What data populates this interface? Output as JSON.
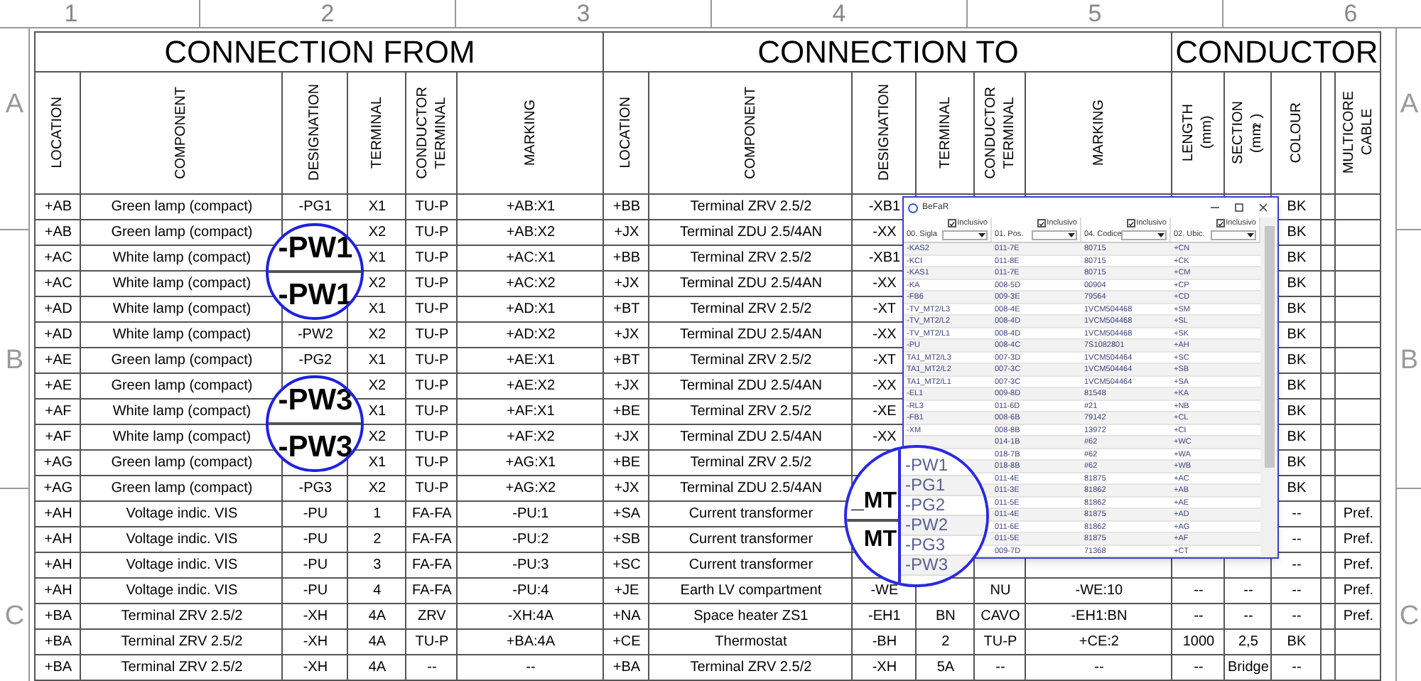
{
  "sheet": {
    "column_numbers": [
      "1",
      "2",
      "3",
      "4",
      "5",
      "6"
    ],
    "row_letters_left": [
      "A",
      "B",
      "C"
    ],
    "row_letters_right": [
      "A",
      "B",
      "C"
    ]
  },
  "table": {
    "groups": [
      {
        "title": "CONNECTION FROM",
        "columns": [
          {
            "label": "LOCATION"
          },
          {
            "label": "COMPONENT"
          },
          {
            "label": "DESIGNATION"
          },
          {
            "label": "TERMINAL"
          },
          {
            "label": "CONDUCTOR\nTERMINAL"
          },
          {
            "label": "MARKING"
          }
        ]
      },
      {
        "title": "CONNECTION TO",
        "columns": [
          {
            "label": "LOCATION"
          },
          {
            "label": "COMPONENT"
          },
          {
            "label": "DESIGNATION"
          },
          {
            "label": "TERMINAL"
          },
          {
            "label": "CONDUCTOR\nTERMINAL"
          },
          {
            "label": "MARKING"
          }
        ]
      },
      {
        "title": "CONDUCTOR",
        "columns": [
          {
            "label": "LENGTH\n(mm)"
          },
          {
            "label": "SECTION\n(mm$^{2}$)"
          },
          {
            "label": "COLOUR"
          },
          {
            "label": "MULTICORE\nCABLE"
          }
        ]
      }
    ],
    "rows": [
      {
        "cells": [
          "+AB",
          "Green lamp (compact)",
          "-PG1",
          "X1",
          "TU-P",
          "+AB:X1",
          "+BB",
          "Terminal ZRV 2.5/2",
          "-XB1",
          null,
          null,
          null,
          null,
          null,
          "BK",
          null,
          null
        ]
      },
      {
        "cells": [
          "+AB",
          "Green lamp (compact)",
          null,
          "X2",
          "TU-P",
          "+AB:X2",
          "+JX",
          "Terminal ZDU 2.5/4AN",
          "-XX",
          null,
          null,
          null,
          null,
          null,
          "BK",
          null,
          null
        ]
      },
      {
        "cells": [
          "+AC",
          "White lamp (compact)",
          null,
          "X1",
          "TU-P",
          "+AC:X1",
          "+BB",
          "Terminal ZRV 2.5/2",
          "-XB1",
          null,
          null,
          null,
          null,
          null,
          "BK",
          null,
          null
        ]
      },
      {
        "cells": [
          "+AC",
          "White lamp (compact)",
          null,
          "X2",
          "TU-P",
          "+AC:X2",
          "+JX",
          "Terminal ZDU 2.5/4AN",
          "-XX",
          null,
          null,
          null,
          null,
          null,
          "BK",
          null,
          null
        ]
      },
      {
        "cells": [
          "+AD",
          "White lamp (compact)",
          null,
          "X1",
          "TU-P",
          "+AD:X1",
          "+BT",
          "Terminal ZRV 2.5/2",
          "-XT",
          null,
          null,
          null,
          null,
          null,
          "BK",
          null,
          null
        ]
      },
      {
        "cells": [
          "+AD",
          "White lamp (compact)",
          "-PW2",
          "X2",
          "TU-P",
          "+AD:X2",
          "+JX",
          "Terminal ZDU 2.5/4AN",
          "-XX",
          null,
          null,
          null,
          null,
          null,
          "BK",
          null,
          null
        ]
      },
      {
        "cells": [
          "+AE",
          "Green lamp (compact)",
          "-PG2",
          "X1",
          "TU-P",
          "+AE:X1",
          "+BT",
          "Terminal ZRV 2.5/2",
          "-XT",
          null,
          null,
          null,
          null,
          null,
          "BK",
          null,
          null
        ]
      },
      {
        "cells": [
          "+AE",
          "Green lamp (compact)",
          null,
          "X2",
          "TU-P",
          "+AE:X2",
          "+JX",
          "Terminal ZDU 2.5/4AN",
          "-XX",
          null,
          null,
          null,
          null,
          null,
          "BK",
          null,
          null
        ]
      },
      {
        "cells": [
          "+AF",
          "White lamp (compact)",
          null,
          "X1",
          "TU-P",
          "+AF:X1",
          "+BE",
          "Terminal ZRV 2.5/2",
          "-XE",
          null,
          null,
          null,
          null,
          null,
          "BK",
          null,
          null
        ]
      },
      {
        "cells": [
          "+AF",
          "White lamp (compact)",
          null,
          "X2",
          "TU-P",
          "+AF:X2",
          "+JX",
          "Terminal ZDU 2.5/4AN",
          "-XX",
          null,
          null,
          null,
          null,
          null,
          "BK",
          null,
          null
        ]
      },
      {
        "cells": [
          "+AG",
          "Green lamp (compact)",
          null,
          "X1",
          "TU-P",
          "+AG:X1",
          "+BE",
          "Terminal ZRV 2.5/2",
          null,
          null,
          null,
          null,
          null,
          null,
          "BK",
          null,
          null
        ]
      },
      {
        "cells": [
          "+AG",
          "Green lamp (compact)",
          "-PG3",
          "X2",
          "TU-P",
          "+AG:X2",
          "+JX",
          "Terminal ZDU 2.5/4AN",
          null,
          null,
          null,
          null,
          null,
          null,
          "BK",
          null,
          null
        ]
      },
      {
        "cells": [
          "+AH",
          "Voltage indic. VIS",
          "-PU",
          "1",
          "FA-FA",
          "-PU:1",
          "+SA",
          "Current transformer",
          null,
          null,
          null,
          null,
          null,
          null,
          "--",
          null,
          "Pref."
        ]
      },
      {
        "cells": [
          "+AH",
          "Voltage indic. VIS",
          "-PU",
          "2",
          "FA-FA",
          "-PU:2",
          "+SB",
          "Current transformer",
          null,
          null,
          null,
          null,
          null,
          null,
          "--",
          null,
          "Pref."
        ]
      },
      {
        "cells": [
          "+AH",
          "Voltage indic. VIS",
          "-PU",
          "3",
          "FA-FA",
          "-PU:3",
          "+SC",
          "Current transformer",
          null,
          null,
          null,
          null,
          null,
          null,
          "--",
          null,
          "Pref."
        ]
      },
      {
        "cells": [
          "+AH",
          "Voltage indic. VIS",
          "-PU",
          "4",
          "FA-FA",
          "-PU:4",
          "+JE",
          "Earth LV compartment",
          "-WE",
          null,
          "NU",
          "-WE:10",
          "--",
          "--",
          "--",
          null,
          "Pref."
        ]
      },
      {
        "cells": [
          "+BA",
          "Terminal ZRV 2.5/2",
          "-XH",
          "4A",
          "ZRV",
          "-XH:4A",
          "+NA",
          "Space heater ZS1",
          "-EH1",
          "BN",
          "CAVO",
          "-EH1:BN",
          "--",
          "--",
          "--",
          null,
          "Pref."
        ]
      },
      {
        "cells": [
          "+BA",
          "Terminal ZRV 2.5/2",
          "-XH",
          "4A",
          "TU-P",
          "+BA:4A",
          "+CE",
          "Thermostat",
          "-BH",
          "2",
          "TU-P",
          "+CE:2",
          "1000",
          "2,5",
          "BK",
          null,
          null
        ]
      },
      {
        "cells": [
          "+BA",
          "Terminal ZRV 2.5/2",
          "-XH",
          "4A",
          "--",
          "--",
          "+BA",
          "Terminal ZRV 2.5/2",
          "-XH",
          "5A",
          "--",
          "--",
          "--",
          "Bridge",
          "--",
          null,
          null
        ]
      }
    ]
  },
  "callouts": [
    {
      "top": "-PW1",
      "bottom": "-PW1"
    },
    {
      "top": "-PW3",
      "bottom": "-PW3"
    }
  ],
  "window": {
    "title": "BeFaR",
    "columns": [
      {
        "label": "00. Sigla",
        "checkbox_label": "Inclusivo",
        "inclusive": true
      },
      {
        "label": "01. Pos.",
        "checkbox_label": "Inclusivo",
        "inclusive": true
      },
      {
        "label": "04. Codice",
        "checkbox_label": "Inclusivo",
        "inclusive": true
      },
      {
        "label": "02. Ubic.",
        "checkbox_label": "Inclusivo",
        "inclusive": true
      }
    ],
    "rows": [
      [
        "-KAS2",
        "011-7E",
        "80715",
        "+CN"
      ],
      [
        "-KCI",
        "011-8E",
        "80715",
        "+CK"
      ],
      [
        "-KAS1",
        "011-7E",
        "80715",
        "+CM"
      ],
      [
        "-KA",
        "008-5D",
        "00904",
        "+CP"
      ],
      [
        "-FB6",
        "009-3E",
        "79564",
        "+CD"
      ],
      [
        "-TV_MT2/L3",
        "008-4E",
        "1VCM504468",
        "+SM"
      ],
      [
        "-TV_MT2/L2",
        "008-4D",
        "1VCM504468",
        "+SL"
      ],
      [
        "-TV_MT2/L1",
        "008-4D",
        "1VCM504468",
        "+SK"
      ],
      [
        "-PU",
        "008-4C",
        "7S1082801",
        "+AH"
      ],
      [
        "TA1_MT2/L3",
        "007-3D",
        "1VCM504464",
        "+SC"
      ],
      [
        "TA1_MT2/L2",
        "007-3C",
        "1VCM504464",
        "+SB"
      ],
      [
        "TA1_MT2/L1",
        "007-3C",
        "1VCM504464",
        "+SA"
      ],
      [
        "-EL1",
        "009-8D",
        "81548",
        "+KA"
      ],
      [
        "-RL3",
        "011-6D",
        "#21",
        "+NB"
      ],
      [
        "-FB1",
        "008-6B",
        "79142",
        "+CL"
      ],
      [
        "-XM",
        "008-8B",
        "13972",
        "+CI"
      ],
      [
        null,
        "014-1B",
        "#62",
        "+WC"
      ],
      [
        null,
        "018-7B",
        "#62",
        "+WA"
      ],
      [
        null,
        "018-8B",
        "#62",
        "+WB"
      ],
      [
        null,
        "011-4E",
        "81875",
        "+AC"
      ],
      [
        null,
        "011-3E",
        "81862",
        "+AB"
      ],
      [
        null,
        "011-5E",
        "81862",
        "+AE"
      ],
      [
        null,
        "011-4E",
        "81875",
        "+AD"
      ],
      [
        null,
        "011-6E",
        "81862",
        "+AG"
      ],
      [
        null,
        "011-5E",
        "81875",
        "+AF"
      ],
      [
        null,
        "009-7D",
        "71368",
        "+CT"
      ]
    ]
  },
  "magnifier": {
    "background_texts": [
      "_MT",
      "MT"
    ],
    "items": [
      "-PW1",
      "-PG1",
      "-PG2",
      "-PW2",
      "-PG3",
      "-PW3"
    ]
  }
}
